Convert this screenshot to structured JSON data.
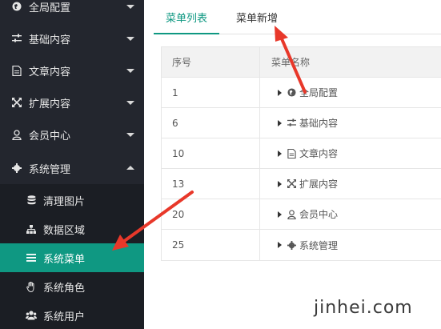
{
  "sidebar": {
    "items": [
      {
        "label": "全局配置",
        "icon": "globe-icon"
      },
      {
        "label": "基础内容",
        "icon": "sliders-icon"
      },
      {
        "label": "文章内容",
        "icon": "document-icon"
      },
      {
        "label": "扩展内容",
        "icon": "expand-icon"
      },
      {
        "label": "会员中心",
        "icon": "user-icon"
      },
      {
        "label": "系统管理",
        "icon": "gear-icon"
      }
    ],
    "submenu": [
      {
        "label": "清理图片",
        "icon": "database-icon"
      },
      {
        "label": "数据区域",
        "icon": "sitemap-icon"
      },
      {
        "label": "系统菜单",
        "icon": "menu-icon",
        "active": true
      },
      {
        "label": "系统角色",
        "icon": "hand-icon"
      },
      {
        "label": "系统用户",
        "icon": "users-icon"
      }
    ]
  },
  "tabs": {
    "list": "菜单列表",
    "add": "菜单新增"
  },
  "table": {
    "headers": {
      "index": "序号",
      "name": "菜单名称"
    },
    "rows": [
      {
        "index": "1",
        "name": "全局配置",
        "icon": "globe-icon"
      },
      {
        "index": "6",
        "name": "基础内容",
        "icon": "sliders-icon"
      },
      {
        "index": "10",
        "name": "文章内容",
        "icon": "document-icon"
      },
      {
        "index": "13",
        "name": "扩展内容",
        "icon": "expand-icon"
      },
      {
        "index": "20",
        "name": "会员中心",
        "icon": "user-icon"
      },
      {
        "index": "25",
        "name": "系统管理",
        "icon": "gear-icon"
      }
    ]
  },
  "colors": {
    "sidebar_bg": "#23262e",
    "submenu_bg": "#1b1e24",
    "accent": "#0f9882",
    "annotation_arrow": "#e8382a"
  },
  "watermark": "jinhei.com"
}
